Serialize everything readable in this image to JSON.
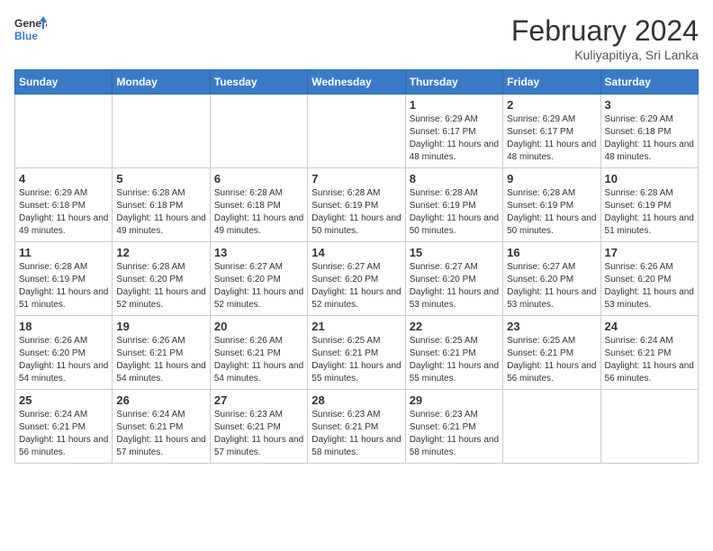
{
  "header": {
    "logo_general": "General",
    "logo_blue": "Blue",
    "title": "February 2024",
    "subtitle": "Kuliyapitiya, Sri Lanka"
  },
  "days_of_week": [
    "Sunday",
    "Monday",
    "Tuesday",
    "Wednesday",
    "Thursday",
    "Friday",
    "Saturday"
  ],
  "weeks": [
    [
      {
        "day": "",
        "info": ""
      },
      {
        "day": "",
        "info": ""
      },
      {
        "day": "",
        "info": ""
      },
      {
        "day": "",
        "info": ""
      },
      {
        "day": "1",
        "info": "Sunrise: 6:29 AM\nSunset: 6:17 PM\nDaylight: 11 hours and 48 minutes."
      },
      {
        "day": "2",
        "info": "Sunrise: 6:29 AM\nSunset: 6:17 PM\nDaylight: 11 hours and 48 minutes."
      },
      {
        "day": "3",
        "info": "Sunrise: 6:29 AM\nSunset: 6:18 PM\nDaylight: 11 hours and 48 minutes."
      }
    ],
    [
      {
        "day": "4",
        "info": "Sunrise: 6:29 AM\nSunset: 6:18 PM\nDaylight: 11 hours and 49 minutes."
      },
      {
        "day": "5",
        "info": "Sunrise: 6:28 AM\nSunset: 6:18 PM\nDaylight: 11 hours and 49 minutes."
      },
      {
        "day": "6",
        "info": "Sunrise: 6:28 AM\nSunset: 6:18 PM\nDaylight: 11 hours and 49 minutes."
      },
      {
        "day": "7",
        "info": "Sunrise: 6:28 AM\nSunset: 6:19 PM\nDaylight: 11 hours and 50 minutes."
      },
      {
        "day": "8",
        "info": "Sunrise: 6:28 AM\nSunset: 6:19 PM\nDaylight: 11 hours and 50 minutes."
      },
      {
        "day": "9",
        "info": "Sunrise: 6:28 AM\nSunset: 6:19 PM\nDaylight: 11 hours and 50 minutes."
      },
      {
        "day": "10",
        "info": "Sunrise: 6:28 AM\nSunset: 6:19 PM\nDaylight: 11 hours and 51 minutes."
      }
    ],
    [
      {
        "day": "11",
        "info": "Sunrise: 6:28 AM\nSunset: 6:19 PM\nDaylight: 11 hours and 51 minutes."
      },
      {
        "day": "12",
        "info": "Sunrise: 6:28 AM\nSunset: 6:20 PM\nDaylight: 11 hours and 52 minutes."
      },
      {
        "day": "13",
        "info": "Sunrise: 6:27 AM\nSunset: 6:20 PM\nDaylight: 11 hours and 52 minutes."
      },
      {
        "day": "14",
        "info": "Sunrise: 6:27 AM\nSunset: 6:20 PM\nDaylight: 11 hours and 52 minutes."
      },
      {
        "day": "15",
        "info": "Sunrise: 6:27 AM\nSunset: 6:20 PM\nDaylight: 11 hours and 53 minutes."
      },
      {
        "day": "16",
        "info": "Sunrise: 6:27 AM\nSunset: 6:20 PM\nDaylight: 11 hours and 53 minutes."
      },
      {
        "day": "17",
        "info": "Sunrise: 6:26 AM\nSunset: 6:20 PM\nDaylight: 11 hours and 53 minutes."
      }
    ],
    [
      {
        "day": "18",
        "info": "Sunrise: 6:26 AM\nSunset: 6:20 PM\nDaylight: 11 hours and 54 minutes."
      },
      {
        "day": "19",
        "info": "Sunrise: 6:26 AM\nSunset: 6:21 PM\nDaylight: 11 hours and 54 minutes."
      },
      {
        "day": "20",
        "info": "Sunrise: 6:26 AM\nSunset: 6:21 PM\nDaylight: 11 hours and 54 minutes."
      },
      {
        "day": "21",
        "info": "Sunrise: 6:25 AM\nSunset: 6:21 PM\nDaylight: 11 hours and 55 minutes."
      },
      {
        "day": "22",
        "info": "Sunrise: 6:25 AM\nSunset: 6:21 PM\nDaylight: 11 hours and 55 minutes."
      },
      {
        "day": "23",
        "info": "Sunrise: 6:25 AM\nSunset: 6:21 PM\nDaylight: 11 hours and 56 minutes."
      },
      {
        "day": "24",
        "info": "Sunrise: 6:24 AM\nSunset: 6:21 PM\nDaylight: 11 hours and 56 minutes."
      }
    ],
    [
      {
        "day": "25",
        "info": "Sunrise: 6:24 AM\nSunset: 6:21 PM\nDaylight: 11 hours and 56 minutes."
      },
      {
        "day": "26",
        "info": "Sunrise: 6:24 AM\nSunset: 6:21 PM\nDaylight: 11 hours and 57 minutes."
      },
      {
        "day": "27",
        "info": "Sunrise: 6:23 AM\nSunset: 6:21 PM\nDaylight: 11 hours and 57 minutes."
      },
      {
        "day": "28",
        "info": "Sunrise: 6:23 AM\nSunset: 6:21 PM\nDaylight: 11 hours and 58 minutes."
      },
      {
        "day": "29",
        "info": "Sunrise: 6:23 AM\nSunset: 6:21 PM\nDaylight: 11 hours and 58 minutes."
      },
      {
        "day": "",
        "info": ""
      },
      {
        "day": "",
        "info": ""
      }
    ]
  ]
}
